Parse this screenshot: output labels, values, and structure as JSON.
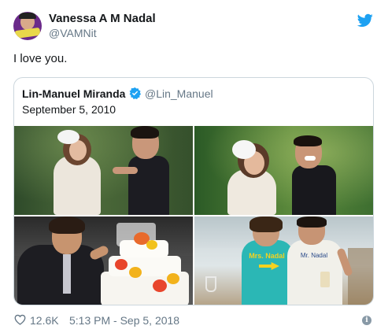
{
  "author": {
    "name": "Vanessa A M Nadal",
    "handle": "@VAMNit"
  },
  "tweet": {
    "text": "I love you."
  },
  "quoted_tweet": {
    "author_name": "Lin-Manuel Miranda",
    "verified": true,
    "author_handle": "@Lin_Manuel",
    "text": "September 5, 2010",
    "photos": [
      "wedding-photo-1",
      "wedding-photo-2",
      "wedding-photo-3",
      "wedding-photo-4"
    ],
    "shirt_text_left": "Mrs. Nadal",
    "shirt_text_right": "Mr. Nadal"
  },
  "footer": {
    "likes": "12.6K",
    "timestamp": "5:13 PM - Sep 5, 2018"
  },
  "colors": {
    "brand": "#1da1f2",
    "text": "#14171a",
    "secondary": "#657786",
    "border": "#ccd6dd"
  },
  "icons": {
    "logo": "twitter-bird-icon",
    "verified": "verified-badge-icon",
    "like": "heart-icon",
    "info": "info-icon"
  }
}
